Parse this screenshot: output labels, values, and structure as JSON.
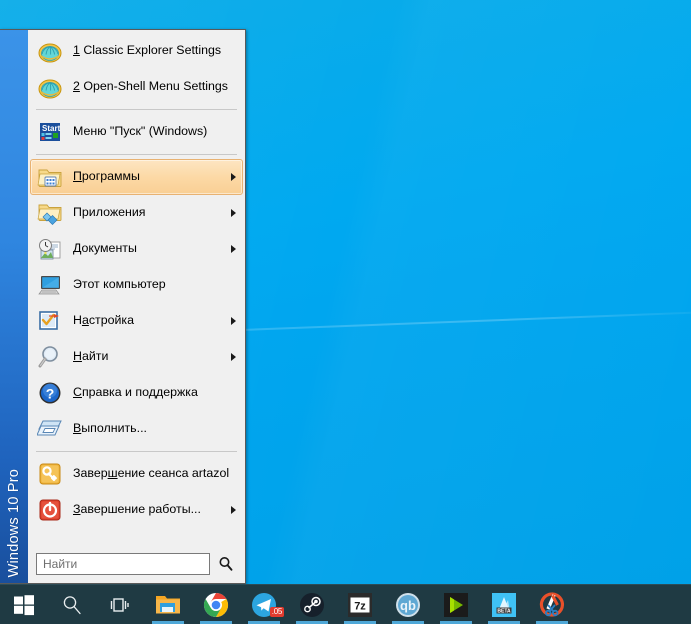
{
  "desktop": {
    "background_top": "#0bace8",
    "background_bottom": "#00a1e8"
  },
  "start_menu": {
    "banner_text": "Windows 10 Pro",
    "banner_color_top": "#3b93e8",
    "banner_color_bottom": "#194f9d",
    "background": "#f0f0f0",
    "highlight_color": "#fcd9a6",
    "groups": [
      {
        "items": [
          {
            "label": "1 Classic Explorer Settings",
            "accel": "1",
            "icon": "open-shell-clamshell-icon",
            "arrow": false,
            "selected": false
          },
          {
            "label": "2 Open-Shell Menu Settings",
            "accel": "2",
            "icon": "open-shell-clamshell-icon",
            "arrow": false,
            "selected": false
          }
        ]
      },
      {
        "items": [
          {
            "label": "Меню \"Пуск\" (Windows)",
            "accel": "",
            "icon": "start-menu-windows-icon",
            "arrow": false,
            "selected": false
          }
        ]
      },
      {
        "items": [
          {
            "label": "Программы",
            "accel": "П",
            "icon": "programs-folder-icon",
            "arrow": true,
            "selected": true
          },
          {
            "label": "Приложения",
            "accel": "",
            "icon": "apps-folder-icon",
            "arrow": true,
            "selected": false
          },
          {
            "label": "Документы",
            "accel": "Д",
            "icon": "documents-recent-icon",
            "arrow": true,
            "selected": false
          },
          {
            "label": "Этот компьютер",
            "accel": "",
            "icon": "this-pc-monitor-icon",
            "arrow": false,
            "selected": false
          },
          {
            "label": "Настройка",
            "accel": "а",
            "icon": "settings-checkbox-icon",
            "arrow": true,
            "selected": false
          },
          {
            "label": "Найти",
            "accel": "Н",
            "icon": "search-magnifier-icon",
            "arrow": true,
            "selected": false
          },
          {
            "label": "Справка и поддержка",
            "accel": "С",
            "icon": "help-question-icon",
            "arrow": false,
            "selected": false
          },
          {
            "label": "Выполнить...",
            "accel": "В",
            "icon": "run-dialog-icon",
            "arrow": false,
            "selected": false
          }
        ]
      },
      {
        "items": [
          {
            "label": "Завершение сеанса artazol",
            "accel": "ш",
            "icon": "logoff-key-icon",
            "arrow": false,
            "selected": false
          },
          {
            "label": "Завершение работы...",
            "accel": "З",
            "icon": "shutdown-power-icon",
            "arrow": true,
            "selected": false
          }
        ]
      }
    ],
    "search": {
      "value": "",
      "placeholder": "Найти",
      "button_icon": "search-magnifier-icon"
    }
  },
  "taskbar": {
    "background": "#1f3a43",
    "indicator_color": "#4fa8d8",
    "buttons": [
      {
        "name": "start-button",
        "icon": "windows-logo-icon",
        "label": "Пуск",
        "running": false,
        "badge": ""
      },
      {
        "name": "search-button",
        "icon": "search-magnifier-icon",
        "label": "Поиск",
        "running": false,
        "badge": ""
      },
      {
        "name": "task-view-button",
        "icon": "task-view-icon",
        "label": "Представление задач",
        "running": false,
        "badge": ""
      },
      {
        "name": "file-explorer-button",
        "icon": "file-explorer-icon",
        "label": "Проводник",
        "running": true,
        "badge": ""
      },
      {
        "name": "google-chrome-button",
        "icon": "google-chrome-icon",
        "label": "Google Chrome",
        "running": true,
        "badge": ""
      },
      {
        "name": "telegram-button",
        "icon": "telegram-icon",
        "label": "Telegram",
        "running": true,
        "badge": ".05"
      },
      {
        "name": "steam-button",
        "icon": "steam-icon",
        "label": "Steam",
        "running": true,
        "badge": ""
      },
      {
        "name": "seven-zip-button",
        "icon": "7zip-icon",
        "label": "7-Zip",
        "running": true,
        "badge": ""
      },
      {
        "name": "qbittorrent-button",
        "icon": "qbittorrent-icon",
        "label": "qBittorrent",
        "running": true,
        "badge": ""
      },
      {
        "name": "nvidia-button",
        "icon": "nvidia-play-icon",
        "label": "NVIDIA",
        "running": true,
        "badge": ""
      },
      {
        "name": "affinity-beta-button",
        "icon": "affinity-beta-icon",
        "label": "Affinity BETA",
        "running": true,
        "badge": ""
      },
      {
        "name": "snipping-tool-button",
        "icon": "snipping-tool-icon",
        "label": "Ножницы",
        "running": true,
        "badge": ""
      }
    ]
  }
}
